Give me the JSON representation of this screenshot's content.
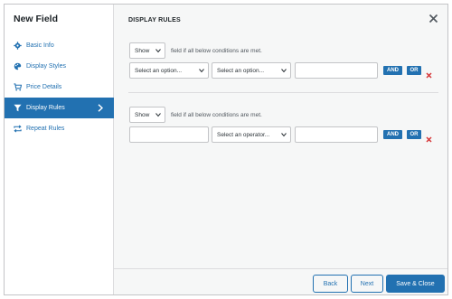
{
  "modal": {
    "title": "New Field"
  },
  "sidebar": {
    "items": [
      {
        "label": "Basic Info",
        "icon": "gear-icon",
        "active": false
      },
      {
        "label": "Display Styles",
        "icon": "palette-icon",
        "active": false
      },
      {
        "label": "Price Details",
        "icon": "cart-icon",
        "active": false
      },
      {
        "label": "Display Rules",
        "icon": "filter-icon",
        "active": true
      },
      {
        "label": "Repeat Rules",
        "icon": "repeat-icon",
        "active": false
      }
    ]
  },
  "main": {
    "section_title": "DISPLAY RULES",
    "rule_groups": [
      {
        "action_value": "Show",
        "condition_text": "field if all below conditions are met.",
        "option_select": "Select an option...",
        "operator_select": "Select an option...",
        "value_input": "",
        "and_label": "AND",
        "or_label": "OR"
      },
      {
        "action_value": "Show",
        "condition_text": "field if all below conditions are met.",
        "option_select": "",
        "operator_select": "Select an operator...",
        "value_input": "",
        "and_label": "AND",
        "or_label": "OR"
      }
    ]
  },
  "footer": {
    "back_label": "Back",
    "next_label": "Next",
    "save_close_label": "Save & Close"
  },
  "colors": {
    "accent": "#2271b1",
    "remove": "#d63638",
    "panel": "#f6f7f7"
  }
}
